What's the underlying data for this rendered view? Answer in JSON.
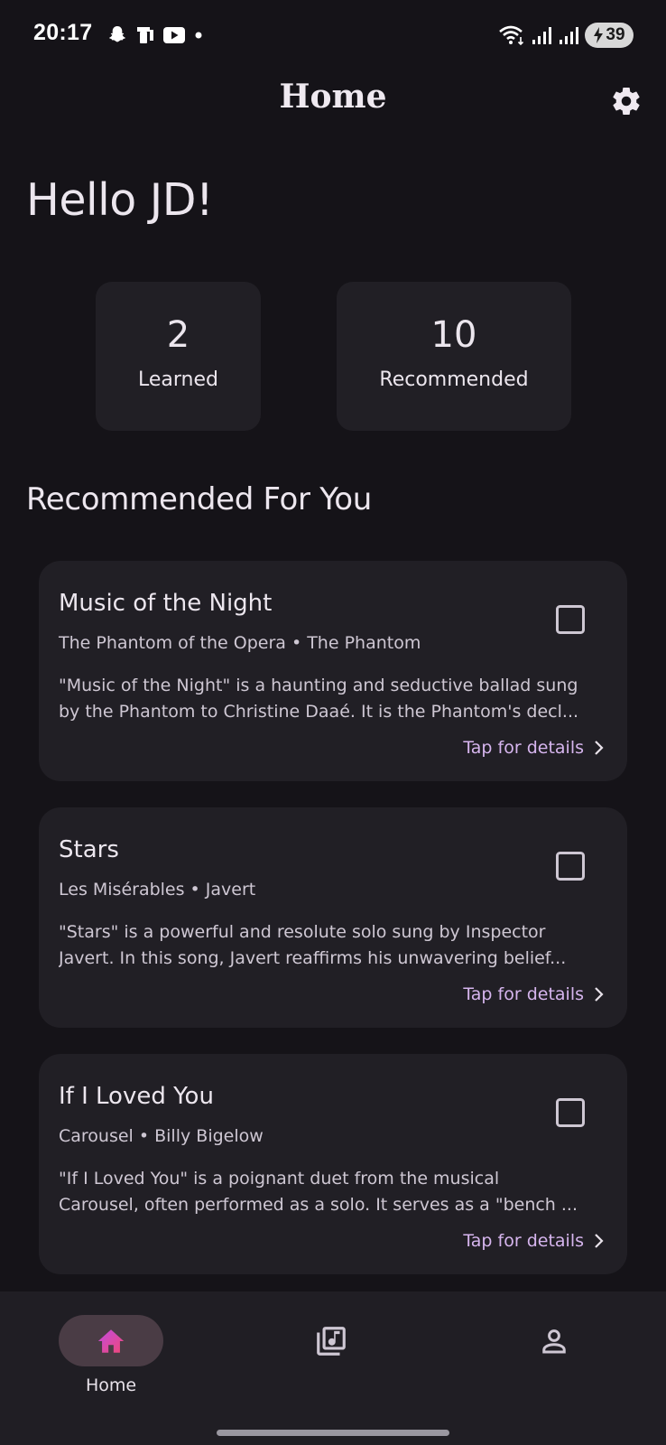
{
  "status_bar": {
    "time": "20:17",
    "battery": "39"
  },
  "header": {
    "title": "Home"
  },
  "greeting": "Hello JD!",
  "stats": [
    {
      "value": "2",
      "label": "Learned"
    },
    {
      "value": "10",
      "label": "Recommended"
    }
  ],
  "section_title": "Recommended For You",
  "songs": [
    {
      "title": "Music of the Night",
      "meta": "The Phantom of the Opera • The Phantom",
      "description_line1": "\"Music of the Night\" is a haunting and seductive ballad sung",
      "description_line2": "by the Phantom to Christine Daaé. It is the Phantom's decl...",
      "details_label": "Tap for details",
      "checked": false
    },
    {
      "title": "Stars",
      "meta": "Les Misérables • Javert",
      "description_line1": "\"Stars\" is a powerful and resolute solo sung by Inspector",
      "description_line2": "Javert. In this song, Javert reaffirms his unwavering belief...",
      "details_label": "Tap for details",
      "checked": false
    },
    {
      "title": "If I Loved You",
      "meta": "Carousel • Billy Bigelow",
      "description_line1": "\"If I Loved You\" is a poignant duet from the musical",
      "description_line2": "Carousel, often performed as a solo. It serves as a \"bench ...",
      "details_label": "Tap for details",
      "checked": false
    }
  ],
  "bottom_nav": {
    "items": [
      {
        "label": "Home",
        "icon": "home-icon",
        "active": true
      },
      {
        "label": "",
        "icon": "library-music-icon",
        "active": false
      },
      {
        "label": "",
        "icon": "person-icon",
        "active": false
      }
    ]
  },
  "colors": {
    "background": "#151318",
    "card": "#211f25",
    "accent_link": "#d6b5ee",
    "active_pill": "#4a3c45",
    "home_icon_gradient_start": "#c04be0",
    "home_icon_gradient_end": "#f04878"
  }
}
